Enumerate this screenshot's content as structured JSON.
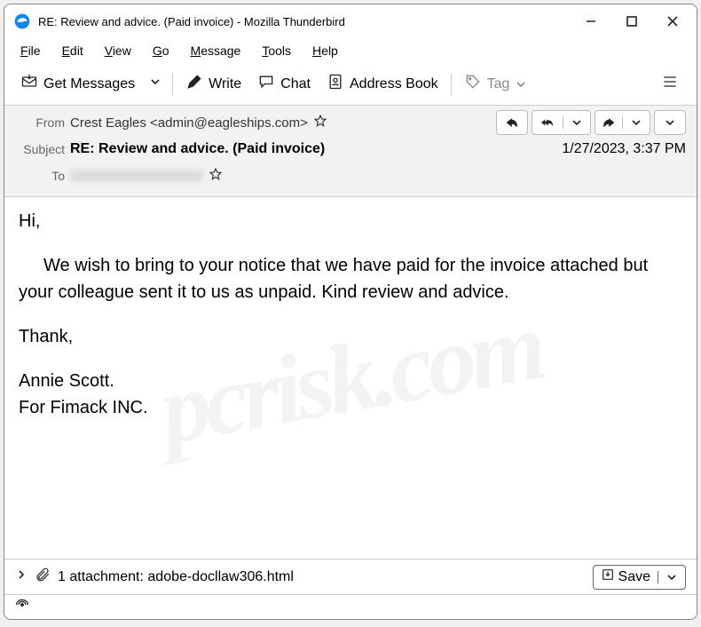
{
  "window": {
    "title": "RE: Review and advice. (Paid invoice) - Mozilla Thunderbird"
  },
  "menubar": {
    "file": "File",
    "edit": "Edit",
    "view": "View",
    "go": "Go",
    "message": "Message",
    "tools": "Tools",
    "help": "Help"
  },
  "toolbar": {
    "get_messages": "Get Messages",
    "write": "Write",
    "chat": "Chat",
    "address_book": "Address Book",
    "tag": "Tag"
  },
  "headers": {
    "from_label": "From",
    "from_value": "Crest Eagles <admin@eagleships.com>",
    "subject_label": "Subject",
    "subject_value": "RE: Review and advice. (Paid invoice)",
    "to_label": "To",
    "date": "1/27/2023, 3:37 PM"
  },
  "body": {
    "greeting": "Hi,",
    "para1": "We wish to bring to your notice that we have paid for the invoice attached but your colleague sent it to us as unpaid. Kind review and advice.",
    "thank": "Thank,",
    "sig1": "Annie Scott.",
    "sig2": "For Fimack INC."
  },
  "attachment": {
    "summary": "1 attachment: adobe-docllaw306.html",
    "save": "Save"
  },
  "watermark": "pcrisk.com"
}
